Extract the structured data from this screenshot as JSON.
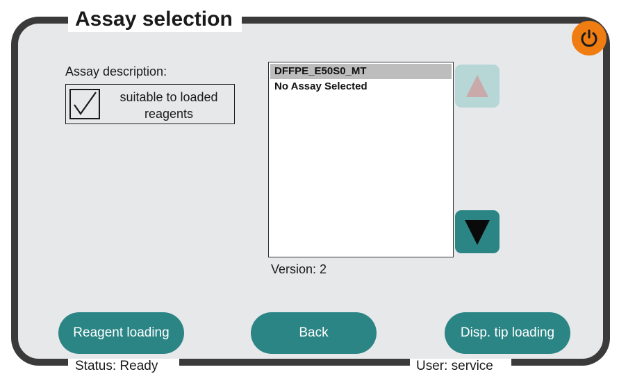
{
  "screen": {
    "title": "Assay selection",
    "accent_color": "#ef7d11",
    "teal_color": "#2b8585"
  },
  "power": {
    "icon": "power-icon"
  },
  "assay": {
    "description_label": "Assay description:",
    "suitable_checked": true,
    "suitable_line1": "suitable to loaded",
    "suitable_line2": "reagents"
  },
  "list": {
    "items": [
      {
        "label": "DFFPE_E50S0_MT",
        "selected": true
      },
      {
        "label": "No Assay Selected",
        "selected": false
      }
    ],
    "version_label": "Version: 2"
  },
  "scroll": {
    "up_icon": "arrow-up-icon",
    "up_enabled": false,
    "down_icon": "arrow-down-icon",
    "down_enabled": true
  },
  "buttons": {
    "reagent_loading": "Reagent loading",
    "back": "Back",
    "disp_tip_loading": "Disp. tip loading"
  },
  "footer": {
    "status": "Status: Ready",
    "user": "User: service"
  }
}
